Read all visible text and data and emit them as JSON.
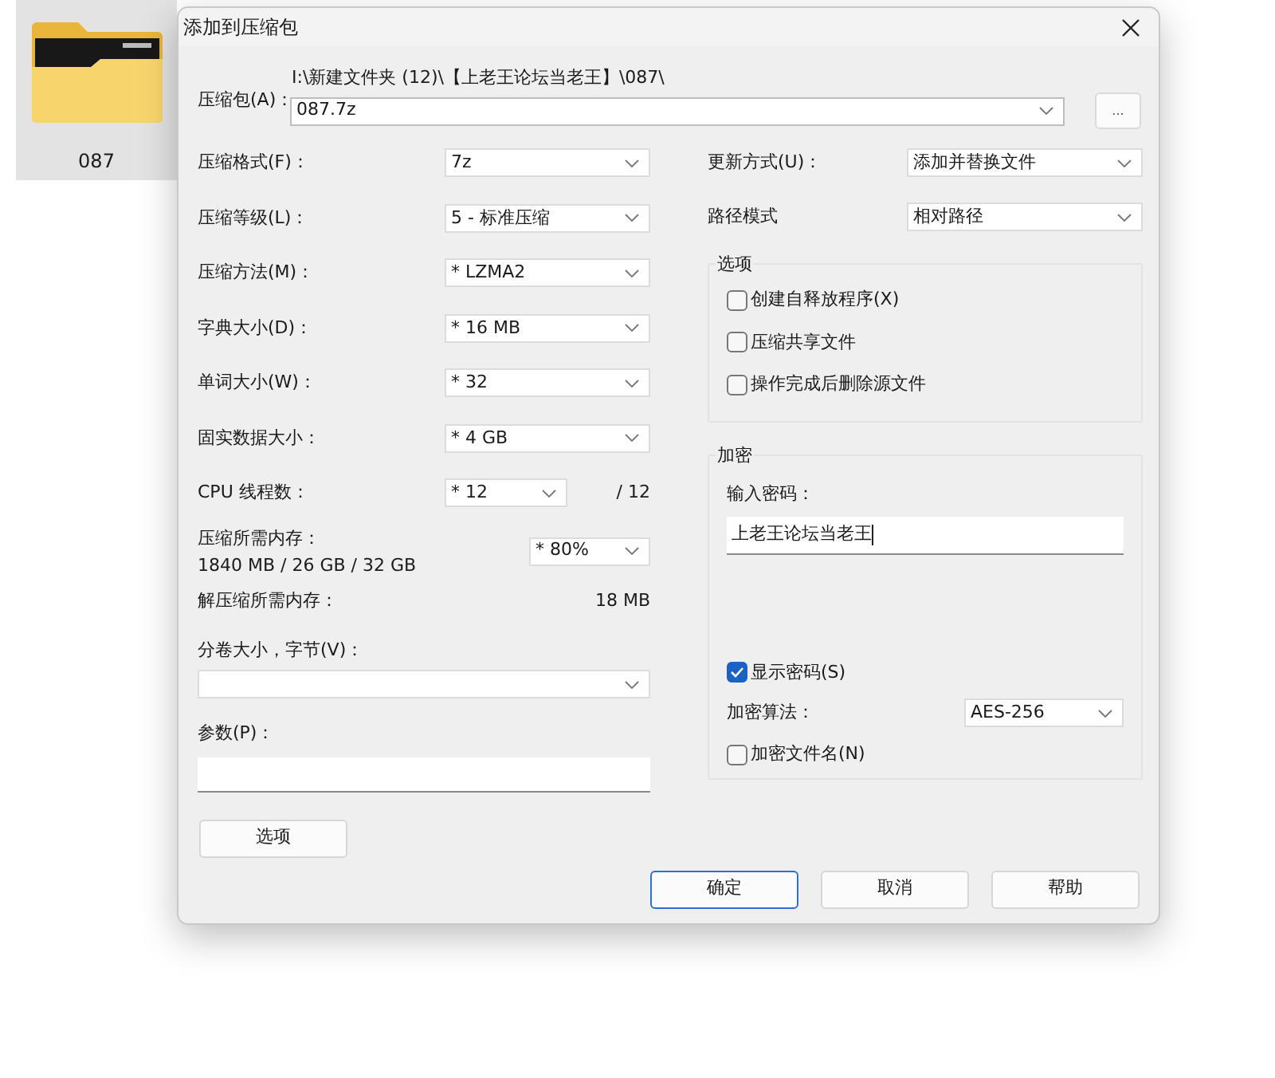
{
  "desktop_item": {
    "label": "087"
  },
  "dialog": {
    "title": "添加到压缩包",
    "archive": {
      "label": "压缩包(A)：",
      "path": "I:\\新建文件夹 (12)\\【上老王论坛当老王】\\087\\",
      "value": "087.7z",
      "browse_button": "..."
    },
    "left_fields": [
      {
        "kind": "select",
        "label": "压缩格式(F)：",
        "value": "7z"
      },
      {
        "kind": "select",
        "label": "压缩等级(L)：",
        "value": "5 - 标准压缩"
      },
      {
        "kind": "select",
        "label": "压缩方法(M)：",
        "value": "* LZMA2"
      },
      {
        "kind": "select",
        "label": "字典大小(D)：",
        "value": "* 16 MB"
      },
      {
        "kind": "select",
        "label": "单词大小(W)：",
        "value": "* 32"
      },
      {
        "kind": "select",
        "label": "固实数据大小：",
        "value": "* 4 GB"
      },
      {
        "kind": "threads",
        "label": "CPU 线程数：",
        "value": "* 12",
        "suffix": "/ 12"
      },
      {
        "kind": "memory",
        "label": "压缩所需内存：",
        "detail": "1840 MB / 26 GB / 32 GB",
        "value": "* 80%"
      },
      {
        "kind": "readout",
        "label": "解压缩所需内存：",
        "value": "18 MB"
      }
    ],
    "volume": {
      "label": "分卷大小，字节(V)："
    },
    "parameters": {
      "label": "参数(P)："
    },
    "options_button": "选项",
    "right_fields": [
      {
        "label": "更新方式(U)：",
        "value": "添加并替换文件"
      },
      {
        "label": "路径模式",
        "value": "相对路径"
      }
    ],
    "options_group": {
      "title": "选项",
      "checkboxes": [
        {
          "label": "创建自释放程序(X)",
          "checked": false
        },
        {
          "label": "压缩共享文件",
          "checked": false
        },
        {
          "label": "操作完成后删除源文件",
          "checked": false
        }
      ]
    },
    "encryption": {
      "title": "加密",
      "password_label": "输入密码：",
      "password": "上老王论坛当老王",
      "show_password": {
        "label": "显示密码(S)",
        "checked": true
      },
      "method_label": "加密算法：",
      "method": "AES-256",
      "encrypt_names": {
        "label": "加密文件名(N)",
        "checked": false
      }
    },
    "buttons": [
      {
        "label": "确定",
        "default": true
      },
      {
        "label": "取消",
        "default": false
      },
      {
        "label": "帮助",
        "default": false
      }
    ]
  }
}
